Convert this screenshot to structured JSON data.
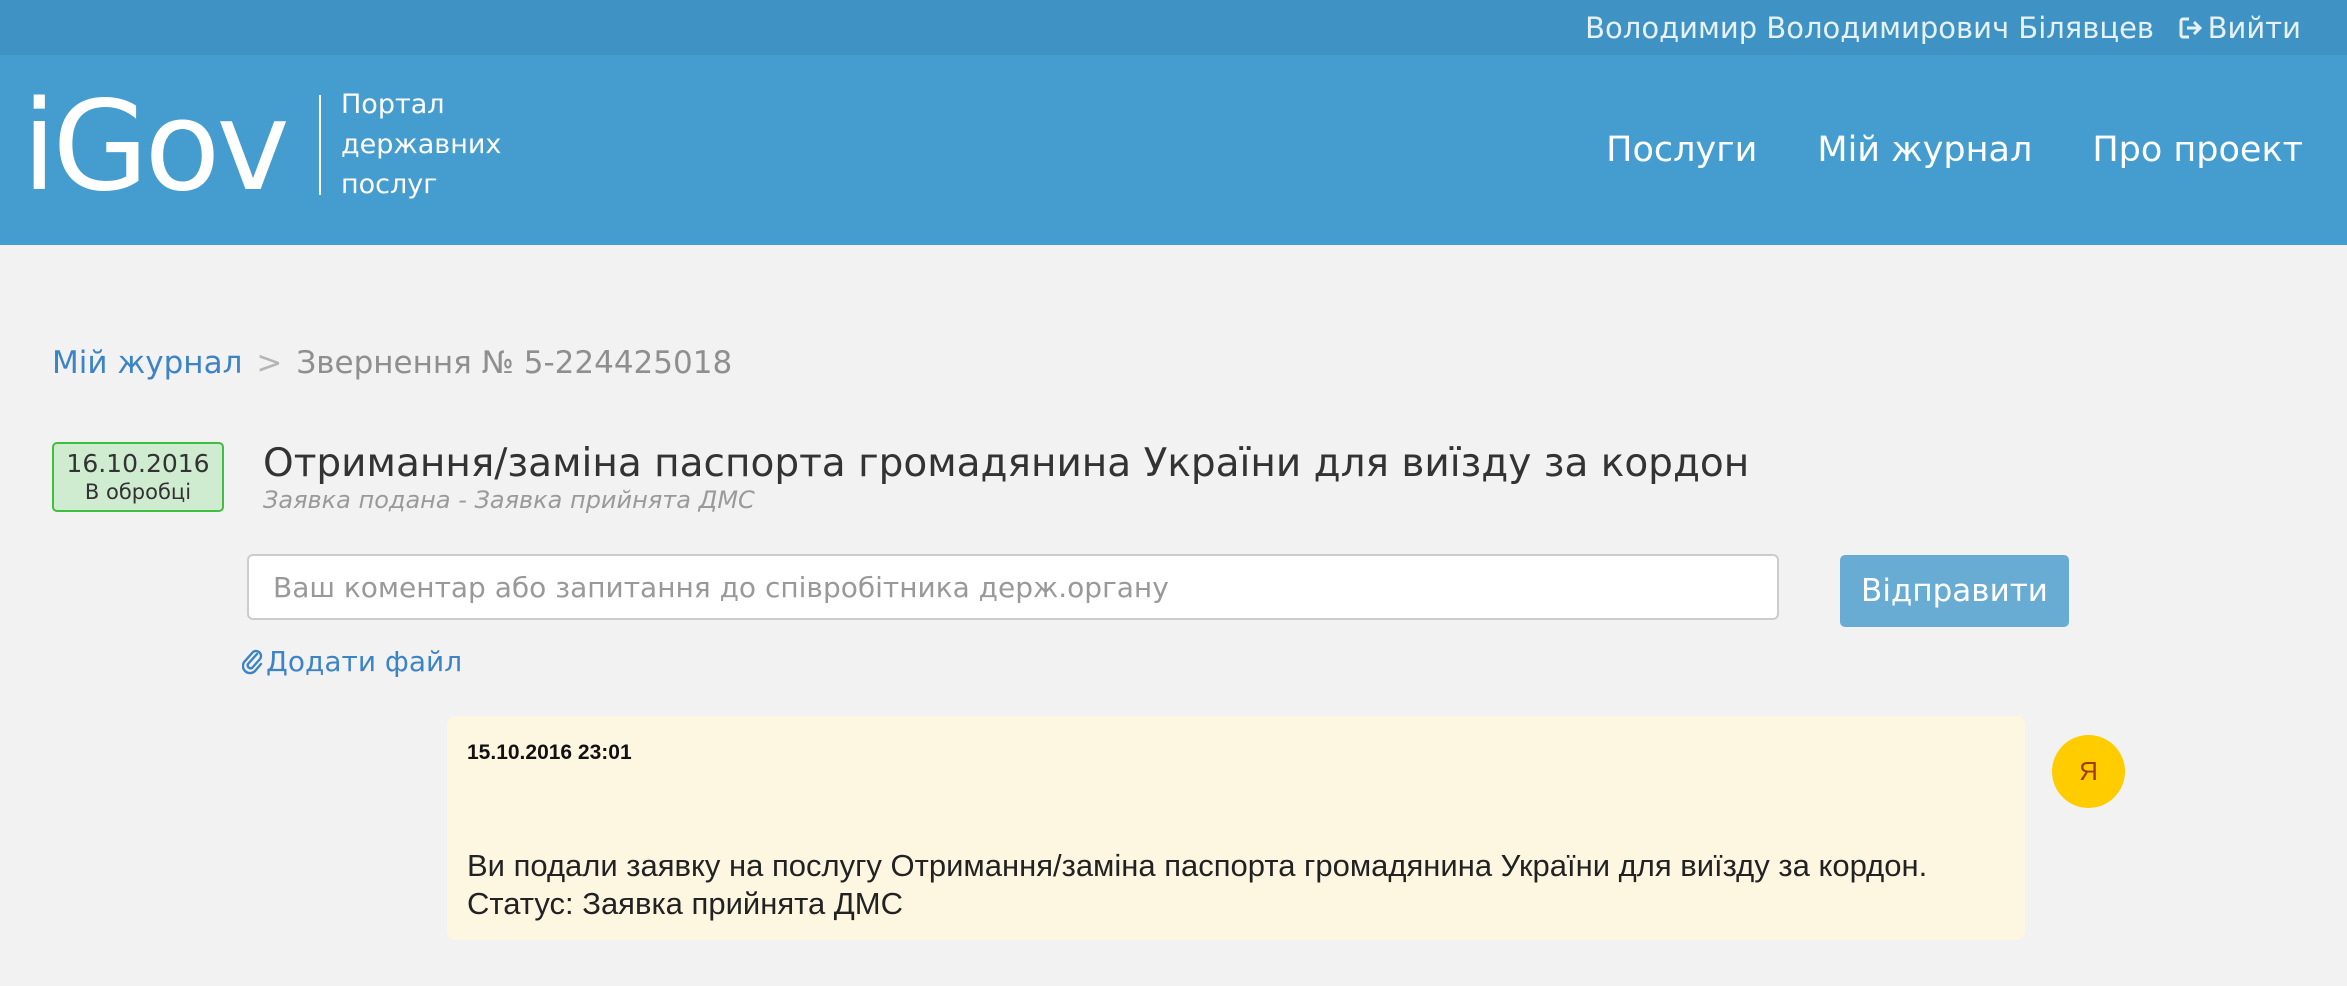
{
  "topbar": {
    "user_name": "Володимир Володимирович Білявцев",
    "logout_label": "Вийти",
    "logout_icon": "sign-out-icon"
  },
  "header": {
    "logo_text": "iGov",
    "logo_subtitle": "Портал державних послуг",
    "nav": [
      {
        "label": "Послуги"
      },
      {
        "label": "Мій журнал"
      },
      {
        "label": "Про проект"
      }
    ]
  },
  "breadcrumb": {
    "parent": "Мій журнал",
    "separator": ">",
    "current": "Звернення № 5-224425018"
  },
  "order": {
    "date": "16.10.2016",
    "state": "В обробці",
    "title": "Отримання/заміна паспорта громадянина України для виїзду за кордон",
    "subtitle": "Заявка подана - Заявка прийнята ДМС"
  },
  "comment": {
    "placeholder": "Ваш коментар або запитання до співробітника держ.органу",
    "value": "",
    "send_label": "Відправити",
    "add_file_label": "Додати файл",
    "add_file_icon": "paperclip-icon"
  },
  "messages": [
    {
      "time": "15.10.2016 23:01",
      "body_line1": "Ви подали заявку на послугу Отримання/заміна паспорта громадянина України для виїзду за кордон.",
      "body_line2": "Статус: Заявка прийнята ДМС",
      "avatar_letter": "Я"
    }
  ],
  "colors": {
    "topbar": "#3f92c4",
    "header": "#459dcf",
    "link": "#3d84c6",
    "status_border": "#3fbf3f",
    "status_bg": "#cfecd1",
    "send_button": "#69acd3",
    "message_bg": "#fdf7e2",
    "avatar": "#ffcc00"
  }
}
